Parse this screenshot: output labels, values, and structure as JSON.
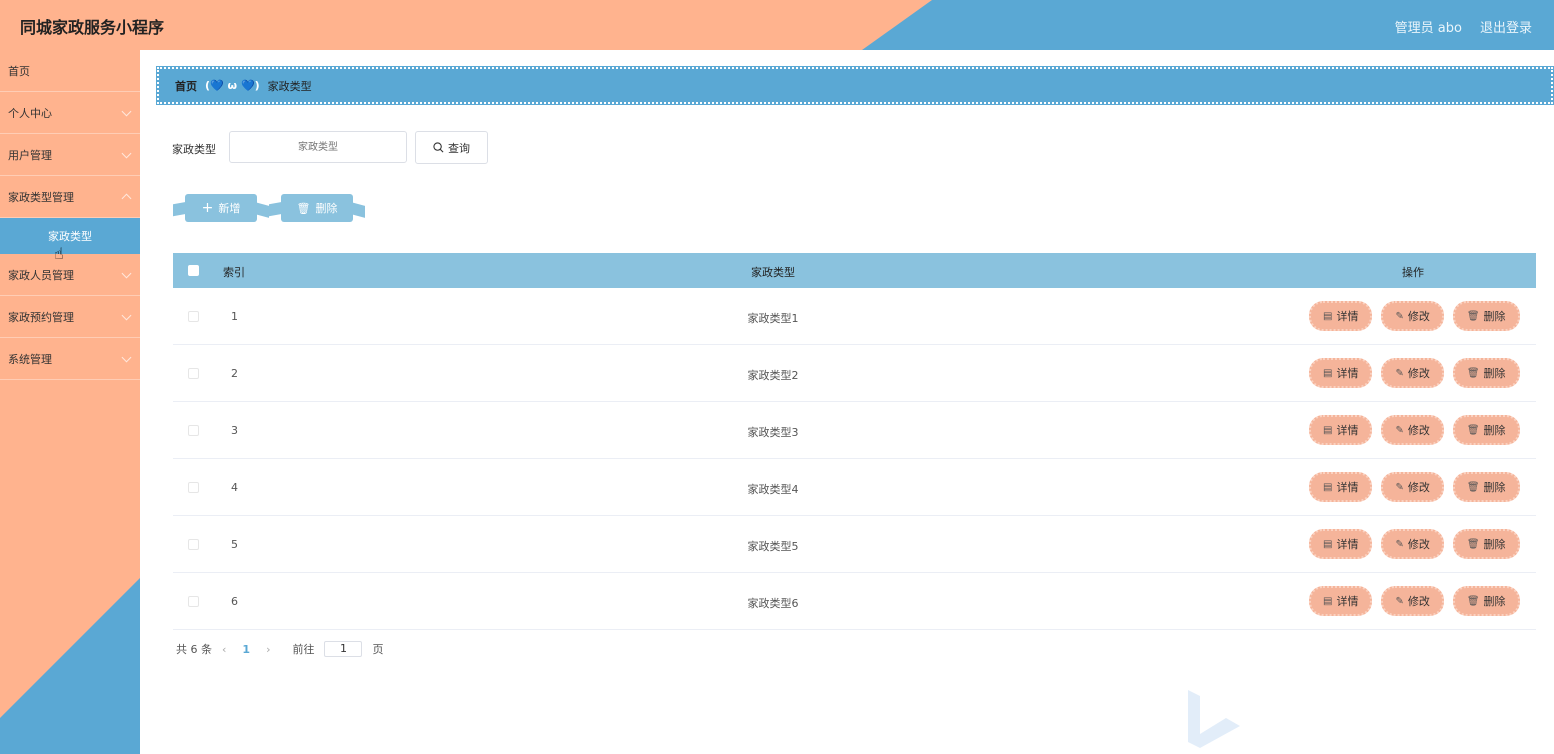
{
  "header": {
    "title": "同城家政服务小程序",
    "user": "管理员 abo",
    "logout": "退出登录"
  },
  "sidebar": {
    "items": [
      {
        "label": "首页",
        "has_arrow": false
      },
      {
        "label": "个人中心",
        "has_arrow": true
      },
      {
        "label": "用户管理",
        "has_arrow": true
      },
      {
        "label": "家政类型管理",
        "has_arrow": true
      },
      {
        "label": "家政人员管理",
        "has_arrow": true
      },
      {
        "label": "家政预约管理",
        "has_arrow": true
      },
      {
        "label": "系统管理",
        "has_arrow": true
      }
    ],
    "active_sub": "家政类型"
  },
  "breadcrumb": {
    "home": "首页",
    "sep": "(💙 ω 💙)",
    "current": "家政类型"
  },
  "search": {
    "label": "家政类型",
    "placeholder": "家政类型",
    "button": "查询"
  },
  "actions": {
    "add": "新增",
    "delete": "删除"
  },
  "table": {
    "headers": {
      "index": "索引",
      "type": "家政类型",
      "ops": "操作"
    },
    "rows": [
      {
        "index": "1",
        "type": "家政类型1"
      },
      {
        "index": "2",
        "type": "家政类型2"
      },
      {
        "index": "3",
        "type": "家政类型3"
      },
      {
        "index": "4",
        "type": "家政类型4"
      },
      {
        "index": "5",
        "type": "家政类型5"
      },
      {
        "index": "6",
        "type": "家政类型6"
      }
    ],
    "row_ops": {
      "detail": "详情",
      "edit": "修改",
      "delete": "删除"
    }
  },
  "pagination": {
    "total": "共 6 条",
    "current": "1",
    "goto_prefix": "前往",
    "goto_value": "1",
    "goto_suffix": "页"
  },
  "colors": {
    "peach": "#ffb38e",
    "blue": "#5aa8d4",
    "table_header": "#8ac2de",
    "op_button": "#f5b49a"
  }
}
